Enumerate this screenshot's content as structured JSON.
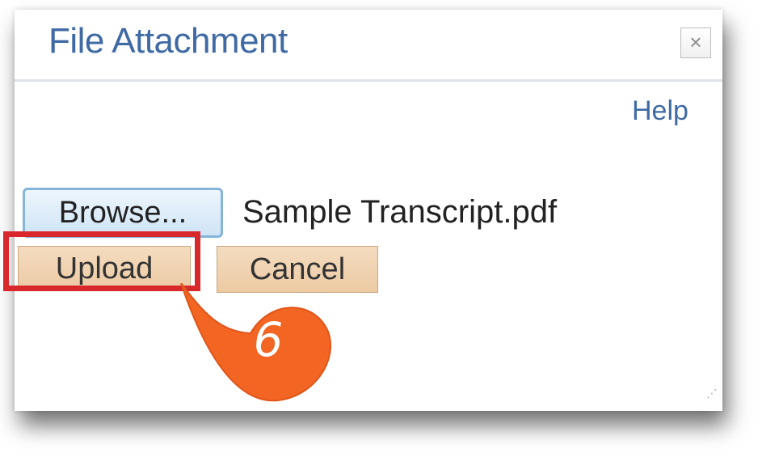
{
  "dialog": {
    "title": "File Attachment",
    "close_label": "×",
    "help_label": "Help",
    "browse_label": "Browse...",
    "file_name": "Sample Transcript.pdf",
    "upload_label": "Upload",
    "cancel_label": "Cancel",
    "resize_grip": "⋰"
  },
  "annotation": {
    "step_number": "6",
    "highlight_color": "#d9282b",
    "callout_color": "#f26522"
  },
  "colors": {
    "title": "#3f6aa4",
    "button_fill": "#eccaa3",
    "browse_border": "#86b5dc"
  }
}
